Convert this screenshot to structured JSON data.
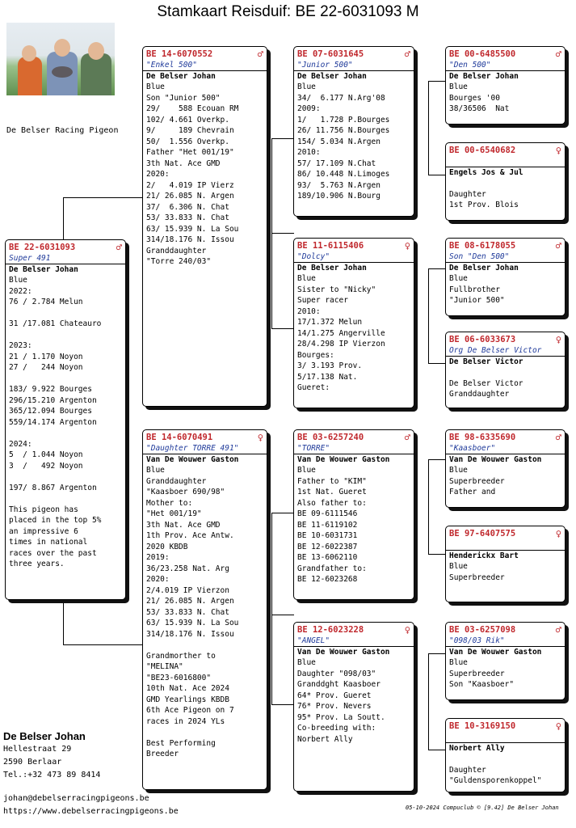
{
  "title": "Stamkaart Reisduif: BE  22-6031093 M",
  "loft": "De Belser Racing Pigeon",
  "owner": {
    "name": "De Belser Johan",
    "lines": [
      "Hellestraat 29",
      "2590  Berlaar",
      "Tel.:+32 473 89 8414"
    ]
  },
  "footer": {
    "email": "johan@debelserracingpigeons.be",
    "web": "https://www.debelserracingpigeons.be"
  },
  "meta": "05-10-2024   Compuclub © [9.42]  De Belser Johan",
  "colors": {
    "ring": "#c0282d",
    "name": "#1f3a9a"
  },
  "cards": {
    "main": {
      "ring": "BE  22-6031093",
      "sex": "♂",
      "name": "Super 491",
      "owner": "De Belser Johan",
      "lines": [
        "Blue",
        "2022:",
        "76 / 2.784 Melun",
        "",
        "31 /17.081 Chateauro",
        "",
        "2023:",
        "21 / 1.170 Noyon",
        "27 /   244 Noyon",
        "",
        "183/ 9.922 Bourges",
        "296/15.210 Argenton",
        "365/12.094 Bourges",
        "559/14.174 Argenton",
        "",
        "2024:",
        "5  / 1.044 Noyon",
        "3  /   492 Noyon",
        "",
        "197/ 8.867 Argenton",
        "",
        "This pigeon has",
        "placed in the top 5%",
        "an impressive 6",
        "times in national",
        "races over the past",
        "three years."
      ]
    },
    "f": {
      "ring": "BE  14-6070552",
      "sex": "♂",
      "name": "\"Enkel 500\"",
      "owner": "De Belser Johan",
      "lines": [
        "Blue",
        "Son \"Junior 500\"",
        "29/    588 Ecouan RM",
        "102/ 4.661 Overkp.",
        "9/     189 Chevrain",
        "50/  1.556 Overkp.",
        "Father \"Het 001/19\"",
        "3th Nat. Ace GMD",
        "2020:",
        "2/   4.019 IP Vierz",
        "21/ 26.085 N. Argen",
        "37/  6.306 N. Chat",
        "53/ 33.833 N. Chat",
        "63/ 15.939 N. La Sou",
        "314/18.176 N. Issou",
        "Granddaughter",
        "\"Torre 240/03\""
      ]
    },
    "m": {
      "ring": "BE  14-6070491",
      "sex": "♀",
      "name": "\"Daughter TORRE 491\"",
      "owner": "Van De Wouwer Gaston",
      "lines": [
        "Blue",
        "Granddaughter",
        "\"Kaasboer 690/98\"",
        "Mother to:",
        "\"Het 001/19\"",
        "3th Nat. Ace GMD",
        "1th Prov. Ace Antw.",
        "2020 KBDB",
        "2019:",
        "36/23.258 Nat. Arg",
        "2020:",
        "2/4.019 IP Vierzon",
        "21/ 26.085 N. Argen",
        "53/ 33.833 N. Chat",
        "63/ 15.939 N. La Sou",
        "314/18.176 N. Issou",
        "",
        "Grandmorther to",
        "\"MELINA\"",
        "\"BE23-6016800\"",
        "10th Nat. Ace 2024",
        "GMD Yearlings KBDB",
        "6th Ace Pigeon on 7",
        "races in 2024 YLs",
        "",
        "Best Performing",
        "Breeder"
      ]
    },
    "ff": {
      "ring": "BE  07-6031645",
      "sex": "♂",
      "name": "\"Junior 500\"",
      "owner": "De Belser Johan",
      "lines": [
        "Blue",
        "34/  6.177 N.Arg'08",
        "2009:",
        "1/   1.728 P.Bourges",
        "26/ 11.756 N.Bourges",
        "154/ 5.034 N.Argen",
        "2010:",
        "57/ 17.109 N.Chat",
        "86/ 10.448 N.Limoges",
        "93/  5.763 N.Argen",
        "189/10.906 N.Bourg"
      ]
    },
    "fm": {
      "ring": "BE  11-6115406",
      "sex": "♀",
      "name": "\"Dolcy\"",
      "owner": "De Belser Johan",
      "lines": [
        "Blue",
        "Sister to \"Nicky\"",
        "Super racer",
        "2010:",
        "17/1.372 Melun",
        "14/1.275 Angerville",
        "28/4.298 IP Vierzon",
        "Bourges:",
        "3/ 3.193 Prov.",
        "5/17.138 Nat.",
        "Gueret:"
      ]
    },
    "mf": {
      "ring": "BE  03-6257240",
      "sex": "♂",
      "name": "\"TORRE\"",
      "owner": "Van De Wouwer Gaston",
      "lines": [
        "Blue",
        "Father to \"KIM\"",
        "1st Nat. Gueret",
        "Also father to:",
        "BE 09-6111546",
        "BE 11-6119102",
        "BE 10-6031731",
        "BE 12-6022387",
        "BE 13-6062110",
        "Grandfather to:",
        "BE 12-6023268"
      ]
    },
    "mm": {
      "ring": "BE  12-6023228",
      "sex": "♀",
      "name": "\"ANGEL\"",
      "owner": "Van De Wouwer Gaston",
      "lines": [
        "Blue",
        "Daughter \"098/03\"",
        "Granddght Kaasboer",
        "64* Prov. Gueret",
        "76* Prov. Nevers",
        "95* Prov. La Soutt.",
        "Co-breeding with:",
        "Norbert Ally"
      ]
    },
    "fff": {
      "ring": "BE  00-6485500",
      "sex": "♂",
      "name": "\"Den 500\"",
      "owner": "De Belser Johan",
      "lines": [
        "Blue",
        "Bourges '00",
        "38/36506  Nat"
      ]
    },
    "ffm": {
      "ring": "BE  00-6540682",
      "sex": "♀",
      "name": "",
      "owner": "Engels Jos & Jul",
      "lines": [
        "",
        "Daughter",
        "1st Prov. Blois"
      ]
    },
    "fmf": {
      "ring": "BE  08-6178055",
      "sex": "♂",
      "name": "Son \"Den 500\"",
      "owner": "De Belser Johan",
      "lines": [
        "Blue",
        "Fullbrother",
        "\"Junior 500\""
      ]
    },
    "fmm": {
      "ring": "BE  06-6033673",
      "sex": "♀",
      "name": "Org De Belser Victor",
      "owner": "De Belser Victor",
      "lines": [
        "",
        "De Belser Victor",
        "Granddaughter"
      ]
    },
    "mff": {
      "ring": "BE  98-6335690",
      "sex": "♂",
      "name": "\"Kaasboer\"",
      "owner": "Van De Wouwer Gaston",
      "lines": [
        "Blue",
        "Superbreeder",
        "Father and"
      ]
    },
    "mfm": {
      "ring": "BE  97-6407575",
      "sex": "♀",
      "name": "",
      "owner": "Henderickx Bart",
      "lines": [
        "Blue",
        "Superbreeder"
      ]
    },
    "mmf": {
      "ring": "BE  03-6257098",
      "sex": "♂",
      "name": "\"098/03 Rik\"",
      "owner": "Van De Wouwer Gaston",
      "lines": [
        "Blue",
        "Superbreeder",
        "Son \"Kaasboer\""
      ]
    },
    "mmm": {
      "ring": "BE  10-3169150",
      "sex": "♀",
      "name": "",
      "owner": "Norbert Ally",
      "lines": [
        "",
        "Daughter",
        "\"Guldensporenkoppel\""
      ]
    }
  }
}
